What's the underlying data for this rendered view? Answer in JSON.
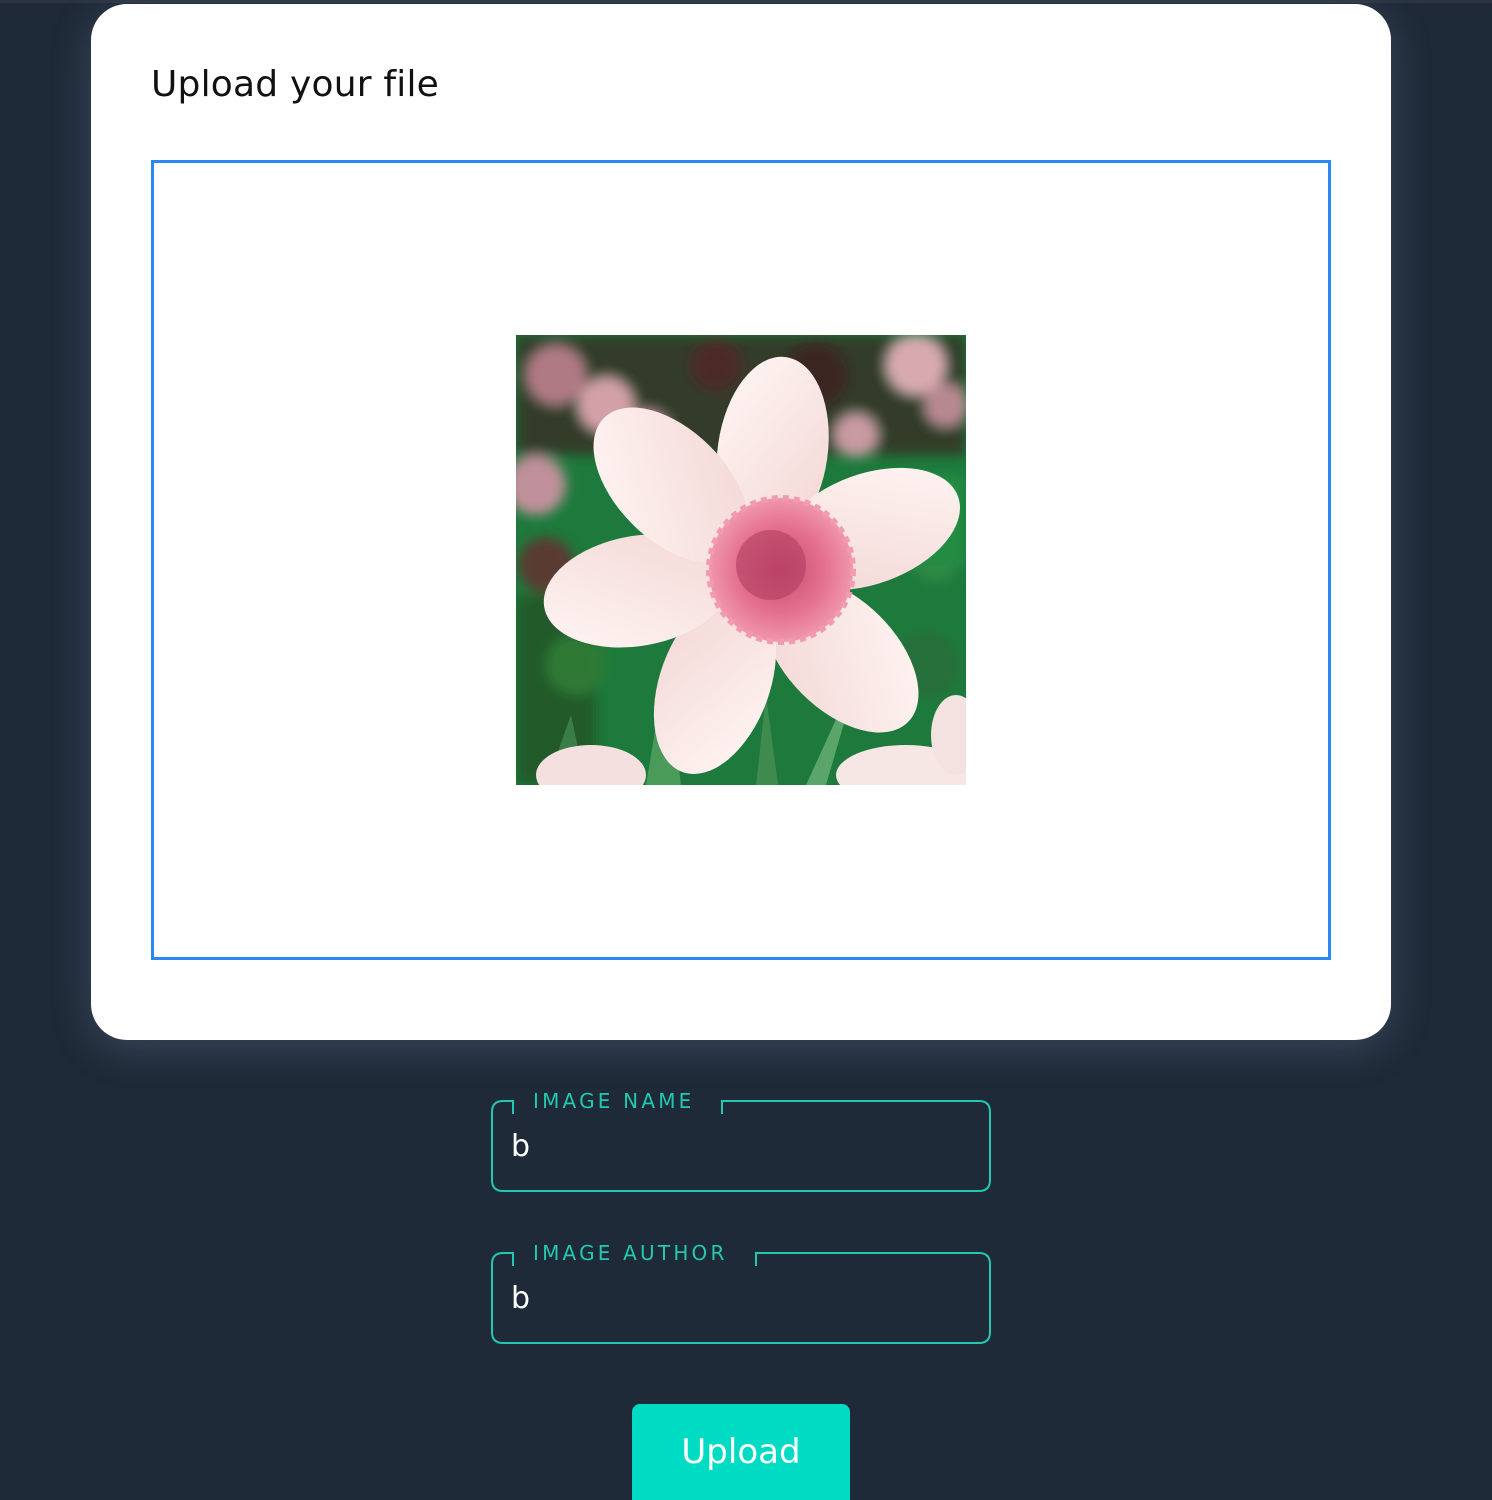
{
  "upload_card": {
    "title": "Upload your file",
    "preview_image": "daffodil-flower-image"
  },
  "form": {
    "image_name": {
      "label": "IMAGE NAME",
      "value": "b"
    },
    "image_author": {
      "label": "IMAGE AUTHOR",
      "value": "b"
    },
    "submit_label": "Upload"
  },
  "colors": {
    "page_background": "#1f2a38",
    "card_background": "#ffffff",
    "dropzone_border": "#2b8af0",
    "accent": "#22c8b0",
    "button": "#00dcc4"
  }
}
